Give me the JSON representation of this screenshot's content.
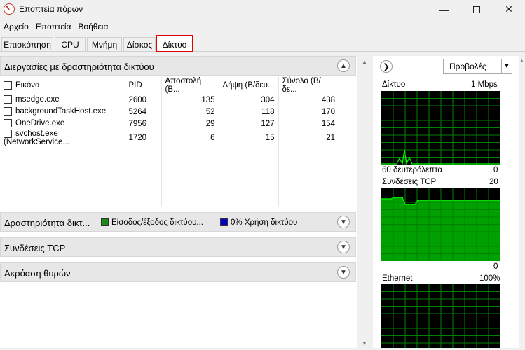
{
  "window": {
    "title": "Εποπτεία πόρων"
  },
  "menu": [
    "Αρχείο",
    "Εποπτεία",
    "Βοήθεια"
  ],
  "tabs": [
    {
      "label": "Επισκόπηση"
    },
    {
      "label": "CPU"
    },
    {
      "label": "Μνήμη"
    },
    {
      "label": "Δίσκος"
    },
    {
      "label": "Δίκτυο",
      "active": true
    }
  ],
  "sections": {
    "processes": "Διεργασίες με δραστηριότητα δικτύου",
    "activity": "Δραστηριότητα δικτ...",
    "tcp": "Συνδέσεις TCP",
    "ports": "Ακρόαση θυρών"
  },
  "activity_legend": {
    "io": "Είσοδος/έξοδος δικτύου...",
    "usage": "0% Χρήση δικτύου",
    "io_color": "#1a8a1a",
    "usage_color": "#0000cc"
  },
  "table": {
    "columns": [
      "Εικόνα",
      "PID",
      "Αποστολή (Β...",
      "Λήψη (Β/δευ...",
      "Σύνολο (Β/δε..."
    ],
    "rows": [
      [
        "msedge.exe",
        "2600",
        "135",
        "304",
        "438"
      ],
      [
        "backgroundTaskHost.exe",
        "5264",
        "52",
        "118",
        "170"
      ],
      [
        "OneDrive.exe",
        "7956",
        "29",
        "127",
        "154"
      ],
      [
        "svchost.exe (NetworkService...",
        "1720",
        "6",
        "15",
        "21"
      ]
    ]
  },
  "right": {
    "views": "Προβολές",
    "network": {
      "label": "Δίκτυο",
      "scale": "1 Mbps",
      "time": "60 δευτερόλεπτα",
      "min": "0"
    },
    "tcp": {
      "label": "Συνδέσεις TCP",
      "scale": "20",
      "min": "0"
    },
    "ethernet": {
      "label": "Ethernet",
      "scale": "100%"
    }
  },
  "colors": {
    "graph_bg": "#000000",
    "graph_grid": "#008000",
    "graph_line": "#00ff00",
    "active_tab_outline": "#e00000"
  }
}
